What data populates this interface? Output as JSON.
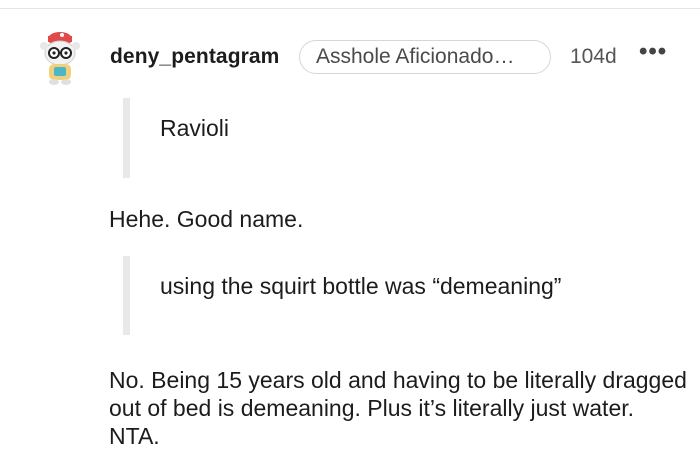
{
  "comment": {
    "username": "deny_pentagram",
    "flair": "Asshole Aficionado…",
    "age": "104d",
    "more_label": "•••",
    "avatar": "snoo-avatar-icon",
    "blocks": {
      "quote1": "Ravioli",
      "para1": "Hehe. Good name.",
      "quote2": "using the squirt bottle was “demeaning”",
      "para2": "No. Being 15 years old and having to be literally dragged out of bed is demeaning. Plus it’s literally just water. NTA."
    }
  }
}
